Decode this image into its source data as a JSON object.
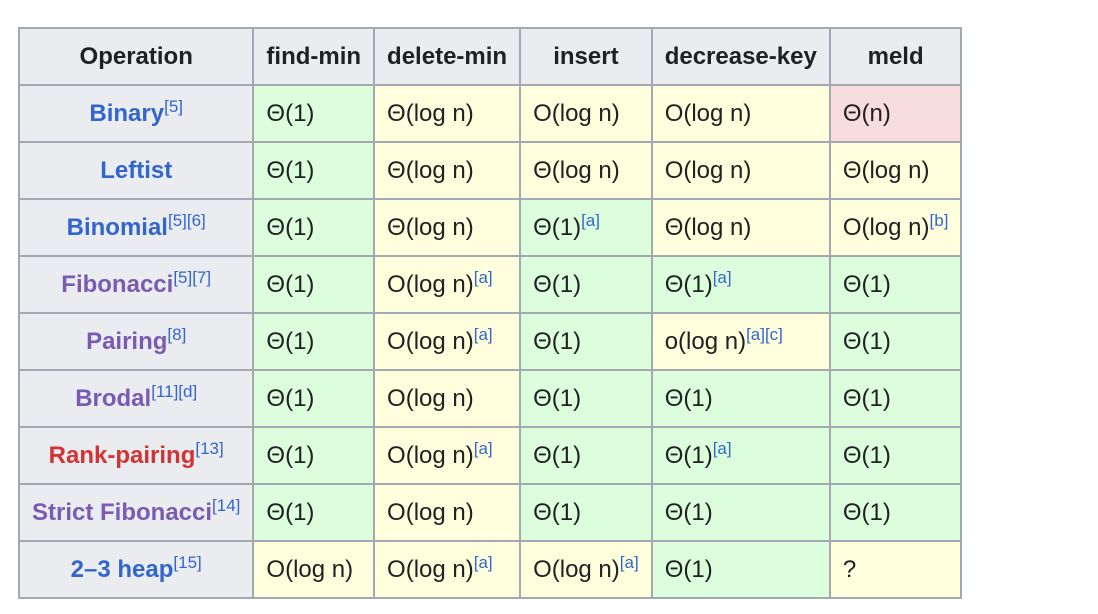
{
  "colors": {
    "link_blue": "#3366cc",
    "link_purple": "#795cb2",
    "link_red": "#d33333",
    "cell_good": "#ddfedd",
    "cell_mid": "#ffffdd",
    "cell_bad": "#f8dde0",
    "header_bg": "#eaecf0"
  },
  "headers": [
    "Operation",
    "find-min",
    "delete-min",
    "insert",
    "decrease-key",
    "meld"
  ],
  "rows": [
    {
      "name": "Binary",
      "refs": "[5]",
      "link": "blue",
      "cells": [
        {
          "c": "g",
          "v": "Θ(1)"
        },
        {
          "c": "y",
          "v": "Θ(log n)"
        },
        {
          "c": "y",
          "v": "O(log n)"
        },
        {
          "c": "y",
          "v": "O(log n)"
        },
        {
          "c": "r",
          "v": "Θ(n)"
        }
      ]
    },
    {
      "name": "Leftist",
      "refs": "",
      "link": "blue",
      "cells": [
        {
          "c": "g",
          "v": "Θ(1)"
        },
        {
          "c": "y",
          "v": "Θ(log n)"
        },
        {
          "c": "y",
          "v": "Θ(log n)"
        },
        {
          "c": "y",
          "v": "O(log n)"
        },
        {
          "c": "y",
          "v": "Θ(log n)"
        }
      ]
    },
    {
      "name": "Binomial",
      "refs": "[5][6]",
      "link": "blue",
      "cells": [
        {
          "c": "g",
          "v": "Θ(1)"
        },
        {
          "c": "y",
          "v": "Θ(log n)"
        },
        {
          "c": "g",
          "v": "Θ(1)",
          "sup": "[a]"
        },
        {
          "c": "y",
          "v": "Θ(log n)"
        },
        {
          "c": "y",
          "v": "O(log n)",
          "sup": "[b]"
        }
      ]
    },
    {
      "name": "Fibonacci",
      "refs": "[5][7]",
      "link": "purple",
      "cells": [
        {
          "c": "g",
          "v": "Θ(1)"
        },
        {
          "c": "y",
          "v": "O(log n)",
          "sup": "[a]"
        },
        {
          "c": "g",
          "v": "Θ(1)"
        },
        {
          "c": "g",
          "v": "Θ(1)",
          "sup": "[a]"
        },
        {
          "c": "g",
          "v": "Θ(1)"
        }
      ]
    },
    {
      "name": "Pairing",
      "refs": "[8]",
      "link": "purple",
      "cells": [
        {
          "c": "g",
          "v": "Θ(1)"
        },
        {
          "c": "y",
          "v": "O(log n)",
          "sup": "[a]"
        },
        {
          "c": "g",
          "v": "Θ(1)"
        },
        {
          "c": "y",
          "v": "o(log n)",
          "sup": "[a][c]"
        },
        {
          "c": "g",
          "v": "Θ(1)"
        }
      ]
    },
    {
      "name": "Brodal",
      "refs": "[11][d]",
      "link": "purple",
      "cells": [
        {
          "c": "g",
          "v": "Θ(1)"
        },
        {
          "c": "y",
          "v": "O(log n)"
        },
        {
          "c": "g",
          "v": "Θ(1)"
        },
        {
          "c": "g",
          "v": "Θ(1)"
        },
        {
          "c": "g",
          "v": "Θ(1)"
        }
      ]
    },
    {
      "name": "Rank-pairing",
      "refs": "[13]",
      "link": "red",
      "cells": [
        {
          "c": "g",
          "v": "Θ(1)"
        },
        {
          "c": "y",
          "v": "O(log n)",
          "sup": "[a]"
        },
        {
          "c": "g",
          "v": "Θ(1)"
        },
        {
          "c": "g",
          "v": "Θ(1)",
          "sup": "[a]"
        },
        {
          "c": "g",
          "v": "Θ(1)"
        }
      ]
    },
    {
      "name": "Strict Fibonacci",
      "refs": "[14]",
      "link": "purple",
      "cells": [
        {
          "c": "g",
          "v": "Θ(1)"
        },
        {
          "c": "y",
          "v": "O(log n)"
        },
        {
          "c": "g",
          "v": "Θ(1)"
        },
        {
          "c": "g",
          "v": "Θ(1)"
        },
        {
          "c": "g",
          "v": "Θ(1)"
        }
      ]
    },
    {
      "name": "2–3 heap",
      "refs": "[15]",
      "link": "blue",
      "cells": [
        {
          "c": "y",
          "v": "O(log n)"
        },
        {
          "c": "y",
          "v": "O(log n)",
          "sup": "[a]"
        },
        {
          "c": "y",
          "v": "O(log n)",
          "sup": "[a]"
        },
        {
          "c": "g",
          "v": "Θ(1)"
        },
        {
          "c": "y",
          "v": "?"
        }
      ]
    }
  ]
}
